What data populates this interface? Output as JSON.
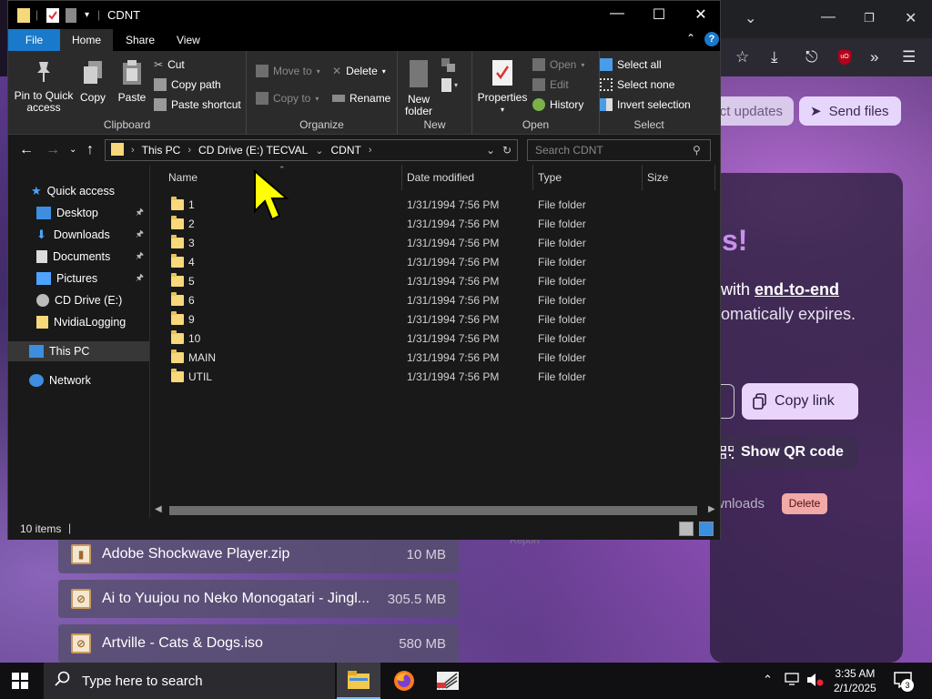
{
  "browser": {
    "page": {
      "updates_label": "ct updates",
      "send_label": "Send files",
      "exclaim": "s!",
      "line1_prefix": "with ",
      "line1_bold": "end-to-end",
      "line2": "omatically expires.",
      "copy_link_label": "Copy link",
      "qr_label": "Show QR code",
      "downloads_text": "wnloads",
      "delete_label": "Delete",
      "report_text": "Report"
    },
    "files": [
      {
        "name": "Adobe Shockwave Player.zip",
        "size": "10 MB"
      },
      {
        "name": "Ai to Yuujou no Neko Monogatari - Jingl...",
        "size": "305.5 MB"
      },
      {
        "name": "Artville - Cats & Dogs.iso",
        "size": "580 MB"
      }
    ],
    "colors": {
      "accent": "#e7d6fb",
      "delete": "#f4a9a9"
    }
  },
  "explorer": {
    "title": "CDNT",
    "tabs": {
      "file": "File",
      "home": "Home",
      "share": "Share",
      "view": "View"
    },
    "ribbon": {
      "clipboard": {
        "label": "Clipboard",
        "pin": "Pin to Quick access",
        "copy": "Copy",
        "paste": "Paste",
        "cut": "Cut",
        "copy_path": "Copy path",
        "paste_shortcut": "Paste shortcut"
      },
      "organize": {
        "label": "Organize",
        "move_to": "Move to",
        "copy_to": "Copy to",
        "delete": "Delete",
        "rename": "Rename"
      },
      "new": {
        "label": "New",
        "new_folder": "New folder"
      },
      "open": {
        "label": "Open",
        "properties": "Properties",
        "open": "Open",
        "edit": "Edit",
        "history": "History"
      },
      "select": {
        "label": "Select",
        "select_all": "Select all",
        "select_none": "Select none",
        "invert": "Invert selection"
      }
    },
    "address": {
      "crumbs": [
        "This PC",
        "CD Drive (E:) TECVAL",
        "CDNT"
      ],
      "search_placeholder": "Search CDNT"
    },
    "nav": {
      "quick_access": "Quick access",
      "desktop": "Desktop",
      "downloads": "Downloads",
      "documents": "Documents",
      "pictures": "Pictures",
      "cd_drive": "CD Drive (E:)",
      "nvidia": "NvidiaLogging",
      "this_pc": "This PC",
      "network": "Network"
    },
    "columns": {
      "name": "Name",
      "date": "Date modified",
      "type": "Type",
      "size": "Size"
    },
    "rows": [
      {
        "name": "1",
        "date": "1/31/1994 7:56 PM",
        "type": "File folder"
      },
      {
        "name": "2",
        "date": "1/31/1994 7:56 PM",
        "type": "File folder"
      },
      {
        "name": "3",
        "date": "1/31/1994 7:56 PM",
        "type": "File folder"
      },
      {
        "name": "4",
        "date": "1/31/1994 7:56 PM",
        "type": "File folder"
      },
      {
        "name": "5",
        "date": "1/31/1994 7:56 PM",
        "type": "File folder"
      },
      {
        "name": "6",
        "date": "1/31/1994 7:56 PM",
        "type": "File folder"
      },
      {
        "name": "9",
        "date": "1/31/1994 7:56 PM",
        "type": "File folder"
      },
      {
        "name": "10",
        "date": "1/31/1994 7:56 PM",
        "type": "File folder"
      },
      {
        "name": "MAIN",
        "date": "1/31/1994 7:56 PM",
        "type": "File folder"
      },
      {
        "name": "UTIL",
        "date": "1/31/1994 7:56 PM",
        "type": "File folder"
      }
    ],
    "status": "10 items",
    "colors": {
      "file_tab": "#1979ca",
      "folder": "#f7d87a"
    }
  },
  "taskbar": {
    "search_placeholder": "Type here to search",
    "time": "3:35 AM",
    "date": "2/1/2025",
    "notifications": "3"
  }
}
